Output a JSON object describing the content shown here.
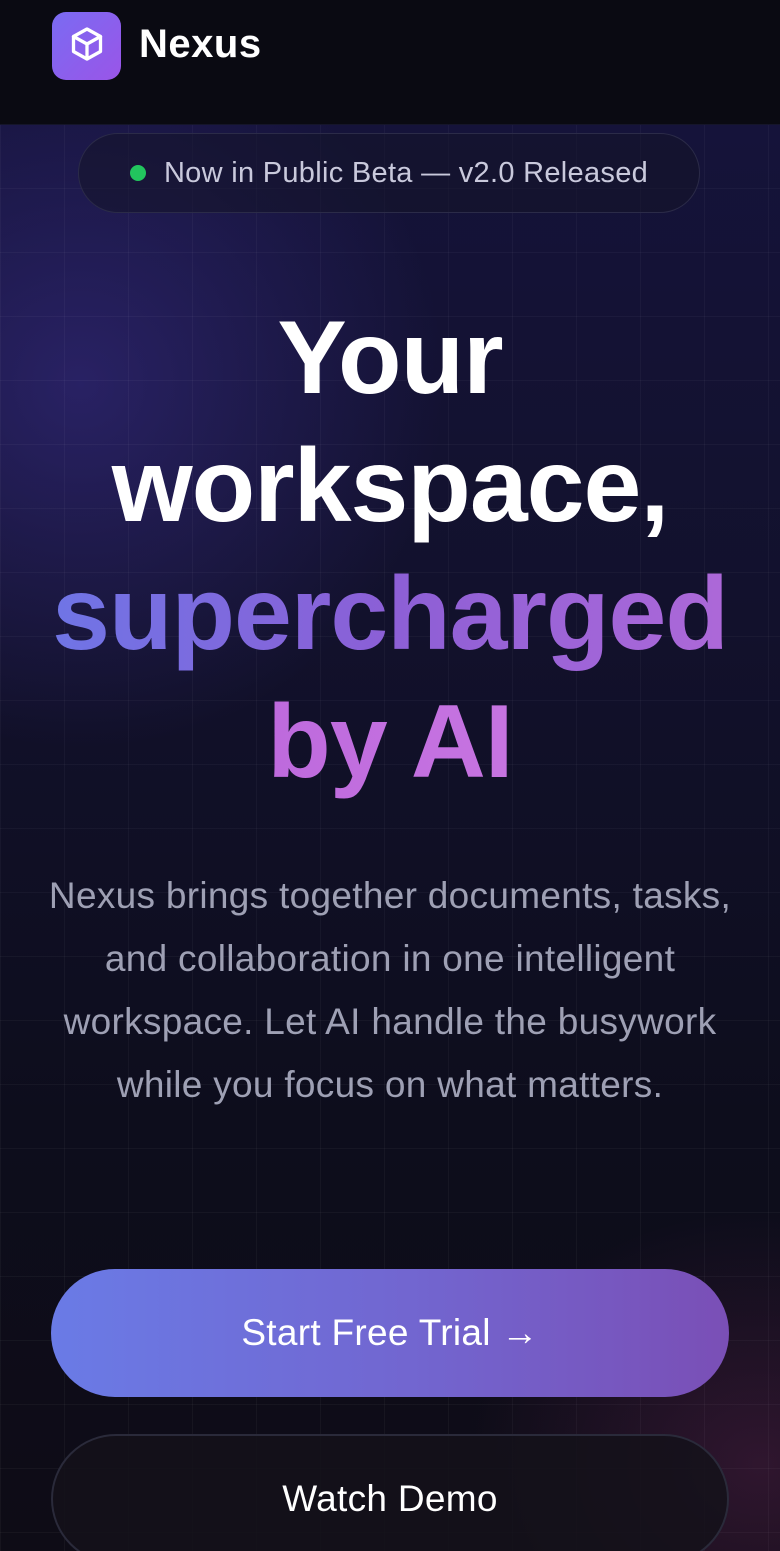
{
  "nav": {
    "brand": "Nexus",
    "logo_icon": "cube-icon"
  },
  "badge": {
    "status_color": "#22c55e",
    "text": "Now in Public Beta — v2.0 Released"
  },
  "hero": {
    "headline_line1": "Your",
    "headline_line2": "workspace,",
    "headline_line3": "supercharged",
    "headline_line4": "by AI",
    "description": "Nexus brings together documents, tasks, and collaboration in one intelligent workspace. Let AI handle the busywork while you focus on what matters."
  },
  "cta": {
    "primary_label": "Start Free Trial →",
    "secondary_label": "Watch Demo"
  },
  "colors": {
    "accent_start": "#6a7be6",
    "accent_end": "#9a55e8",
    "background": "#0b0b16"
  }
}
